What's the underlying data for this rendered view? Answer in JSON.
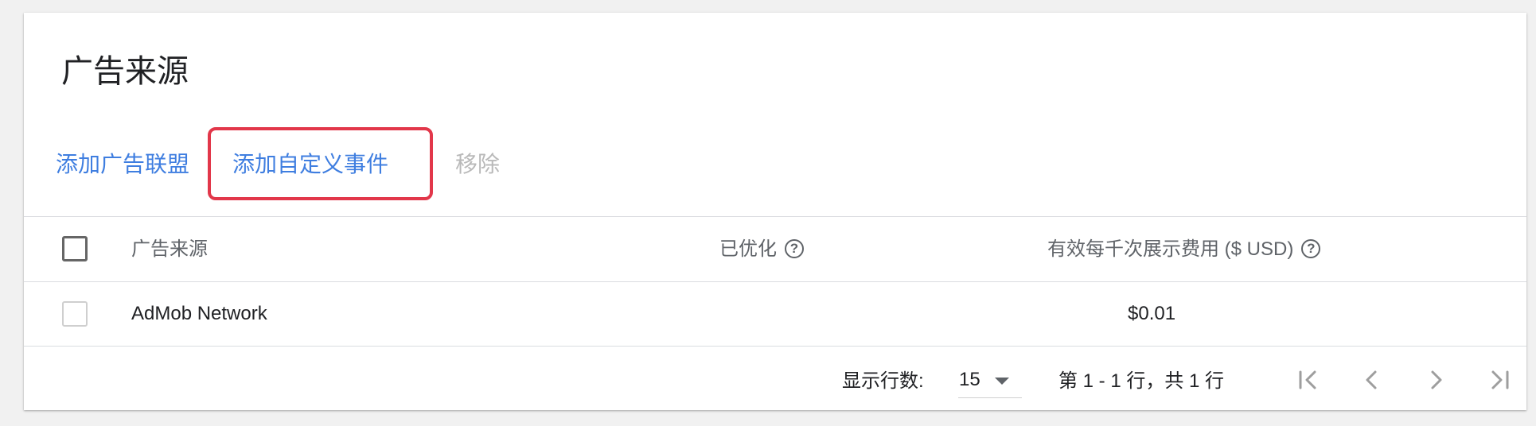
{
  "panel": {
    "title": "广告来源"
  },
  "actions": {
    "add_network": "添加广告联盟",
    "add_custom_event": "添加自定义事件",
    "remove": "移除"
  },
  "table": {
    "columns": {
      "source": "广告来源",
      "optimized": "已优化",
      "ecpm": "有效每千次展示费用 ($ USD)"
    },
    "rows": [
      {
        "source": "AdMob Network",
        "optimized": "",
        "ecpm": "$0.01"
      }
    ]
  },
  "pagination": {
    "rows_per_page_label": "显示行数:",
    "rows_per_page_value": "15",
    "range_text": "第 1 - 1 行，共 1 行"
  },
  "icons": {
    "help": "help-circle-icon",
    "first_page": "first-page-icon",
    "prev_page": "chevron-left-icon",
    "next_page": "chevron-right-icon",
    "last_page": "last-page-icon",
    "dropdown": "caret-down-icon"
  },
  "colors": {
    "link": "#3f7ee0",
    "disabled": "#b9b9b9",
    "highlight": "#e2374a"
  }
}
